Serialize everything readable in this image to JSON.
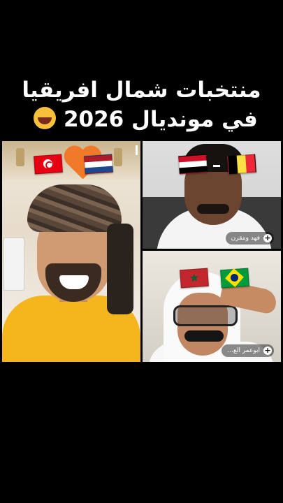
{
  "caption": {
    "line1": "منتخبات شمال افريقيا",
    "line2": "في مونديال 2026",
    "emoji": "rolling-on-floor-laughing-emoji"
  },
  "tiles": {
    "left": {
      "flags": [
        "tunisia-flag",
        "netherlands-flag"
      ],
      "icon": "heart-icon"
    },
    "top_right": {
      "flags": [
        "egypt-flag",
        "belgium-flag"
      ],
      "name": "فهد ومقرن"
    },
    "bottom_right": {
      "flags": [
        "morocco-flag",
        "brazil-flag"
      ],
      "name": "ابوعمر الع..."
    }
  },
  "colors": {
    "background": "#000000",
    "caption_text": "#ffffff",
    "shirt_yellow": "#f5b51c"
  }
}
